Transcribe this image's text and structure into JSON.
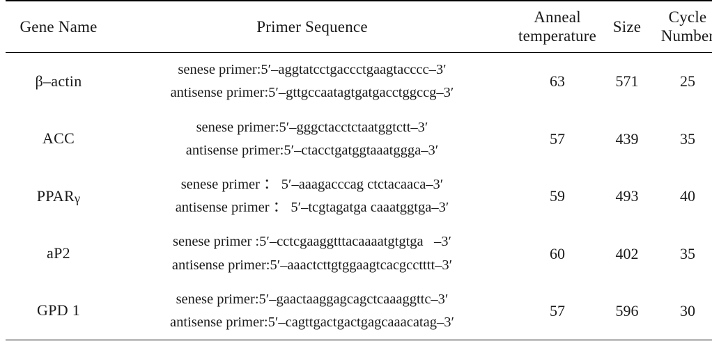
{
  "table": {
    "headers": {
      "gene_name": "Gene Name",
      "primer_sequence": "Primer Sequence",
      "anneal_line1": "Anneal",
      "anneal_line2": "temperature",
      "size": "Size",
      "cycle_line1": "Cycle",
      "cycle_line2": "Number"
    },
    "rows": [
      {
        "gene_name_prefix": "β–actin",
        "gene_name_suffix": "",
        "sense": "senese primer:5′–aggtatcctgaccctgaagtacccc–3′",
        "antisense": "antisense primer:5′–gttgccaatagtgatgacctggccg–3′",
        "anneal_temperature": "63",
        "size": "571",
        "cycle_number": "25"
      },
      {
        "gene_name_prefix": "ACC",
        "gene_name_suffix": "",
        "sense": "senese primer:5′–gggctacctctaatggtctt–3′",
        "antisense": "antisense primer:5′–ctacctgatggtaaatggga–3′",
        "anneal_temperature": "57",
        "size": "439",
        "cycle_number": "35"
      },
      {
        "gene_name_prefix": "PPAR",
        "gene_name_suffix": "γ",
        "sense": "senese primer ： 5′–aaagacccag ctctacaaca–3′",
        "antisense": "antisense primer ： 5′–tcgtagatga caaatggtga–3′",
        "anneal_temperature": "59",
        "size": "493",
        "cycle_number": "40"
      },
      {
        "gene_name_prefix": "aP2",
        "gene_name_suffix": "",
        "sense": "senese primer :5′–cctcgaaggtttacaaaatgtgtga   –3′",
        "antisense": "antisense primer:5′–aaactcttgtggaagtcacgcctttt–3′",
        "anneal_temperature": "60",
        "size": "402",
        "cycle_number": "35"
      },
      {
        "gene_name_prefix": "GPD 1",
        "gene_name_suffix": "",
        "sense": "senese primer:5′–gaactaaggagcagctcaaaggttc–3′",
        "antisense": "antisense primer:5′–cagttgactgactgagcaaacatag–3′",
        "anneal_temperature": "57",
        "size": "596",
        "cycle_number": "30"
      }
    ]
  },
  "colors": {
    "text": "#1a1a1a",
    "rule": "#000000",
    "background": "#ffffff"
  }
}
